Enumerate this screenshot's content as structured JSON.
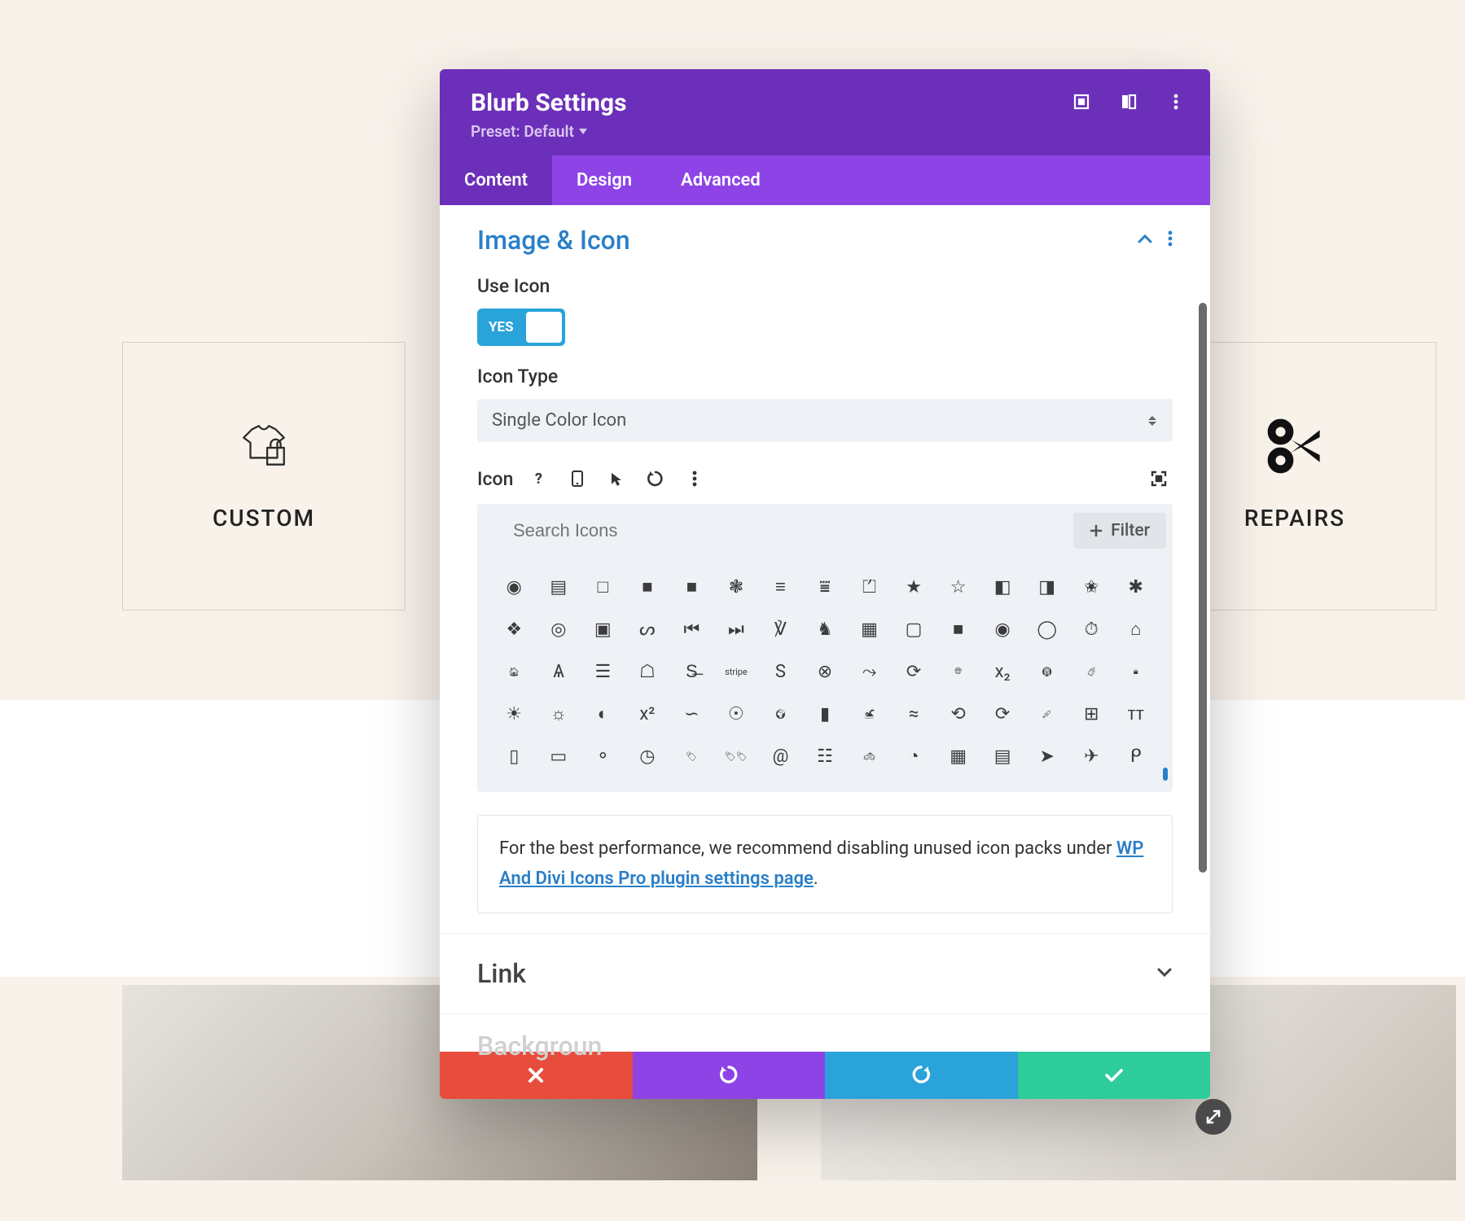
{
  "cards": {
    "left": {
      "caption": "CUSTOM"
    },
    "right": {
      "caption": "REPAIRS"
    }
  },
  "modal": {
    "title": "Blurb Settings",
    "preset": "Preset: Default",
    "tabs": {
      "content": "Content",
      "design": "Design",
      "advanced": "Advanced"
    },
    "section_image_icon": "Image & Icon",
    "use_icon_label": "Use Icon",
    "toggle_yes": "YES",
    "icon_type_label": "Icon Type",
    "icon_type_value": "Single Color Icon",
    "icon_label": "Icon",
    "search_placeholder": "Search Icons",
    "filter_label": "Filter",
    "note_prefix": "For the best performance, we recommend disabling unused icon packs under ",
    "note_link": "WP And Divi Icons Pro plugin settings page",
    "note_suffix": ".",
    "section_link": "Link",
    "section_background_prefix": "Backgroun"
  },
  "icons": {
    "row1": [
      "spotify",
      "spray-can",
      "square-o",
      "square",
      "square-fill",
      "squarespace",
      "stack",
      "stackoverflow",
      "stamp",
      "star",
      "star-o",
      "star-half",
      "star-half-o",
      "star-half-alt",
      "asterisk"
    ],
    "row2": [
      "layers",
      "steam",
      "steam-sq",
      "steam-sym",
      "step-back",
      "step-fwd",
      "stethoscope",
      "horse",
      "sticky",
      "sticky-o",
      "stop",
      "stop-circle",
      "stop-circle-o",
      "stopwatch",
      "store"
    ],
    "row3": [
      "storefront",
      "strava",
      "stream",
      "street-view",
      "strike",
      "stripe",
      "stripe-s",
      "stroop",
      "studiov",
      "stumble",
      "globe",
      "subscript",
      "subway",
      "suitcase",
      "lock"
    ],
    "row4": [
      "sun",
      "sun-o",
      "superpowers",
      "superscript",
      "supple",
      "surprise",
      "globe-af",
      "swatch",
      "swimmer",
      "pool",
      "sync",
      "sync-alt",
      "syringe",
      "table",
      "tt"
    ],
    "row5": [
      "tablet",
      "tablet-alt",
      "pills",
      "dashboard",
      "tag",
      "tags",
      "snail",
      "tasks",
      "taxi",
      "teamspeak",
      "teeth",
      "teeth-open",
      "telegram",
      "plane",
      "tencent"
    ]
  }
}
